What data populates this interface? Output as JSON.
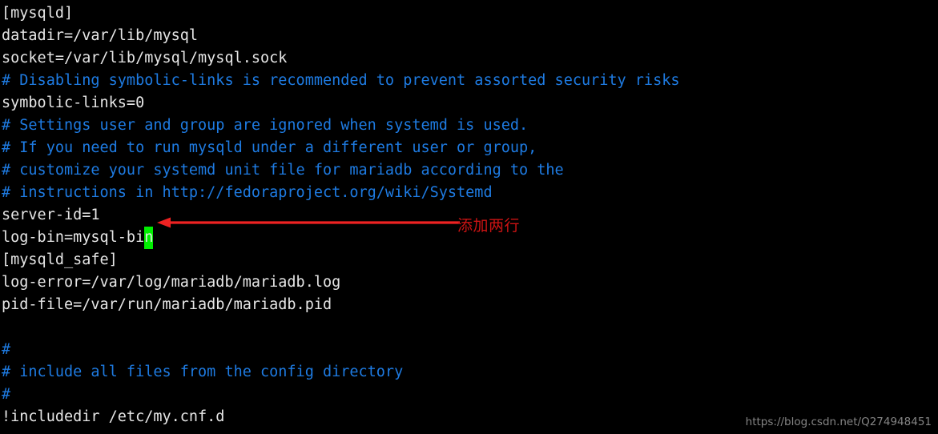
{
  "terminal": {
    "background_color": "#000000",
    "text_color": "#e6e6e6",
    "comment_color": "#1E7BE2",
    "cursor_color": "#00EE00",
    "lines": [
      {
        "text": "[mysqld]",
        "kind": "plain"
      },
      {
        "text": "datadir=/var/lib/mysql",
        "kind": "plain"
      },
      {
        "text": "socket=/var/lib/mysql/mysql.sock",
        "kind": "plain"
      },
      {
        "text": "# Disabling symbolic-links is recommended to prevent assorted security risks",
        "kind": "comment"
      },
      {
        "text": "symbolic-links=0",
        "kind": "plain"
      },
      {
        "text": "# Settings user and group are ignored when systemd is used.",
        "kind": "comment"
      },
      {
        "text": "# If you need to run mysqld under a different user or group,",
        "kind": "comment"
      },
      {
        "text": "# customize your systemd unit file for mariadb according to the",
        "kind": "comment"
      },
      {
        "text": "# instructions in http://fedoraproject.org/wiki/Systemd",
        "kind": "comment"
      },
      {
        "text": "server-id=1",
        "kind": "plain"
      },
      {
        "text": "log-bin=mysql-bi",
        "kind": "plain",
        "cursor": "n"
      },
      {
        "text": "[mysqld_safe]",
        "kind": "plain"
      },
      {
        "text": "log-error=/var/log/mariadb/mariadb.log",
        "kind": "plain"
      },
      {
        "text": "pid-file=/var/run/mariadb/mariadb.pid",
        "kind": "plain"
      },
      {
        "text": "",
        "kind": "blank"
      },
      {
        "text": "#",
        "kind": "comment"
      },
      {
        "text": "# include all files from the config directory",
        "kind": "comment"
      },
      {
        "text": "#",
        "kind": "comment"
      },
      {
        "text": "!includedir /etc/my.cnf.d",
        "kind": "plain"
      }
    ]
  },
  "annotation": {
    "label": "添加两行",
    "color": "#CC1313",
    "arrow_color": "#EE2222",
    "arrow_direction": "left"
  },
  "watermark": {
    "text": "https://blog.csdn.net/Q274948451",
    "color": "#8d8d8d"
  }
}
